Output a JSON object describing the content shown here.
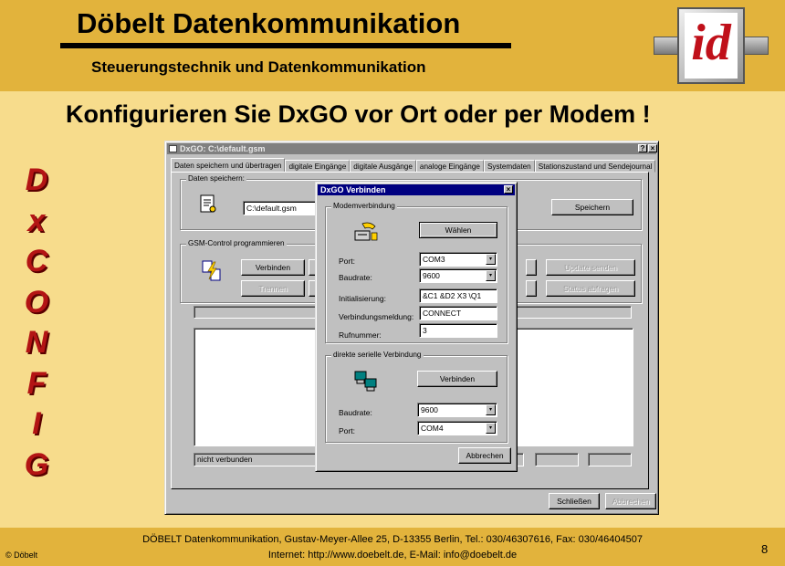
{
  "slide": {
    "company": "Döbelt Datenkommunikation",
    "subtitle": "Steuerungstechnik und Datenkommunikation",
    "logo_text": "id",
    "headline": "Konfigurieren Sie DxGO vor Ort oder per Modem !",
    "side_letters": [
      "D",
      "x",
      "C",
      "O",
      "N",
      "F",
      "I",
      "G"
    ],
    "footer_line1": "DÖBELT Datenkommunikation, Gustav-Meyer-Allee 25, D-13355 Berlin, Tel.: 030/46307616, Fax: 030/46404507",
    "footer_line2": "Internet: http://www.doebelt.de, E-Mail: info@doebelt.de",
    "copyright": "© Döbelt",
    "page_number": "8",
    "colors": {
      "header": "#e2b33c",
      "background": "#f7dc8c",
      "side_letters": "#b31414"
    }
  },
  "main_window": {
    "title": "DxGO: C:\\default.gsm",
    "help_button": "?",
    "close_button": "×",
    "tabs": [
      "Daten speichern und übertragen",
      "digitale Eingänge",
      "digitale Ausgänge",
      "analoge Eingänge",
      "Systemdaten",
      "Stationszustand und Sendejournal"
    ],
    "save_group": {
      "label": "Daten speichern:",
      "file_path": "C:\\default.gsm",
      "save_button": "Speichern"
    },
    "gsm_group": {
      "label": "GSM-Control programmieren",
      "connect_button": "Verbinden",
      "disconnect_button": "Trennen",
      "update_button": "Update senden",
      "status_button": "Status abfragen",
      "status_text": "nicht verbunden"
    },
    "close_label": "Schließen",
    "abort_label": "Abbrechen"
  },
  "dialog": {
    "title": "DxGO Verbinden",
    "close_button": "×",
    "modem_group": {
      "label": "Modemverbindung",
      "select_button": "Wählen",
      "port_label": "Port:",
      "port_value": "COM3",
      "baud_label": "Baudrate:",
      "baud_value": "9600",
      "init_label": "Initialisierung:",
      "init_value": "&C1 &D2 X3 \\Q1",
      "connect_msg_label": "Verbindungsmeldung:",
      "connect_msg_value": "CONNECT",
      "rings_label": "Rufnummer:",
      "rings_value": "3"
    },
    "serial_group": {
      "label": "direkte serielle Verbindung",
      "connect_button": "Verbinden",
      "baud_label": "Baudrate:",
      "baud_value": "9600",
      "port_label": "Port:",
      "port_value": "COM4"
    },
    "cancel_button": "Abbrechen"
  }
}
